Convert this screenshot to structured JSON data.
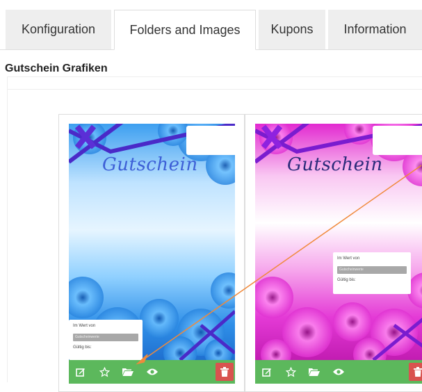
{
  "tabs": [
    {
      "label": "Konfiguration",
      "active": false
    },
    {
      "label": "Folders and Images",
      "active": true
    },
    {
      "label": "Kupons",
      "active": false
    },
    {
      "label": "Information",
      "active": false
    }
  ],
  "section": {
    "title": "Gutschein Grafiken"
  },
  "cards": [
    {
      "theme": "blue",
      "voucher_title": "Gutschein",
      "form_value_label": "Im Wert von",
      "form_value_field": "Gutscheinwerte",
      "form_valid_label": "Gültig bis:"
    },
    {
      "theme": "pink",
      "voucher_title": "Gutschein",
      "form_value_label": "Im Wert von",
      "form_value_field": "Gutscheinwerte",
      "form_valid_label": "Gültig bis:"
    }
  ],
  "actions": [
    {
      "name": "edit-icon"
    },
    {
      "name": "star-icon"
    },
    {
      "name": "folder-open-icon"
    },
    {
      "name": "eye-icon"
    },
    {
      "name": "trash-icon"
    }
  ],
  "colors": {
    "action_bar": "#5cb85c",
    "delete": "#d9534f",
    "annotation_arrow": "#f08a3c",
    "blue_theme": "#2f8fe8",
    "pink_theme": "#e83ad7"
  }
}
